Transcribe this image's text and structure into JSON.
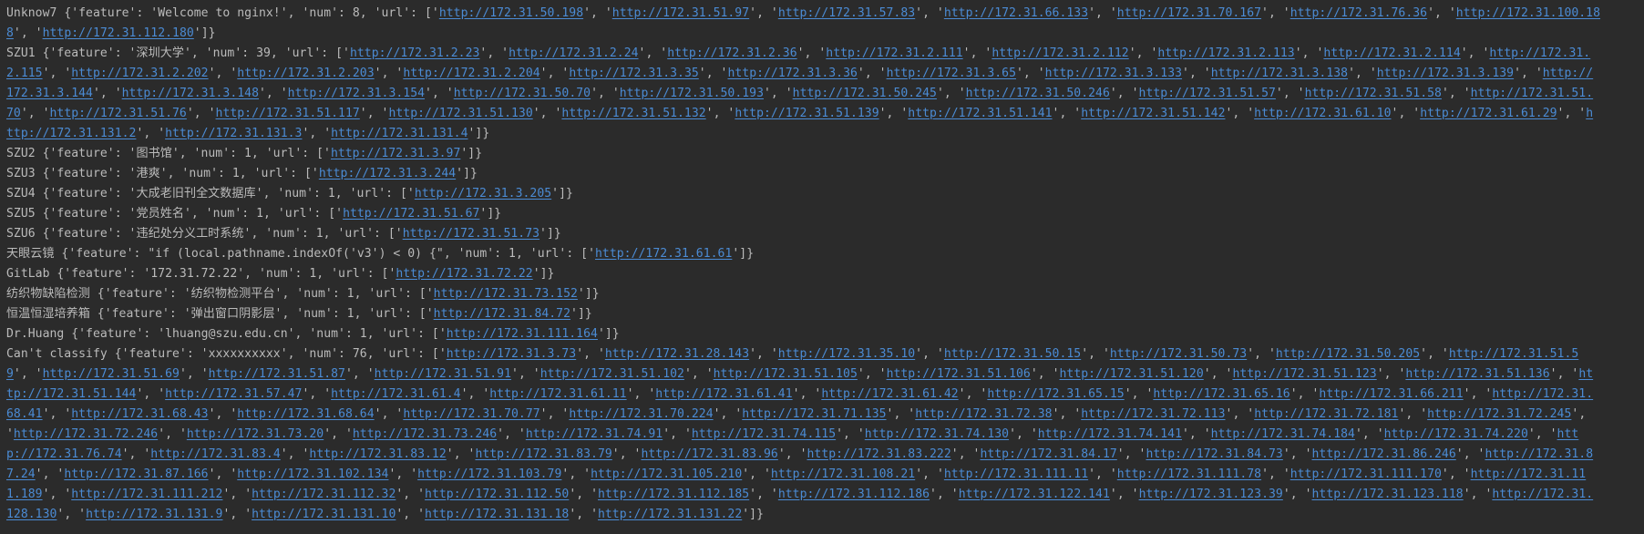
{
  "theme": {
    "background": "#2b2b2b",
    "text": "#bbbbbb",
    "link": "#4b8bd4"
  },
  "lines": [
    {
      "label": "Unknow7",
      "feature": "'Welcome to nginx!'",
      "num": "8",
      "urls": [
        "http://172.31.50.198",
        "http://172.31.51.97",
        "http://172.31.57.83",
        "http://172.31.66.133",
        "http://172.31.70.167",
        "http://172.31.76.36",
        "http://172.31.100.188",
        "http://172.31.112.180"
      ]
    },
    {
      "label": "SZU1",
      "feature": "'深圳大学'",
      "num": "39",
      "urls": [
        "http://172.31.2.23",
        "http://172.31.2.24",
        "http://172.31.2.36",
        "http://172.31.2.111",
        "http://172.31.2.112",
        "http://172.31.2.113",
        "http://172.31.2.114",
        "http://172.31.2.115",
        "http://172.31.2.202",
        "http://172.31.2.203",
        "http://172.31.2.204",
        "http://172.31.3.35",
        "http://172.31.3.36",
        "http://172.31.3.65",
        "http://172.31.3.133",
        "http://172.31.3.138",
        "http://172.31.3.139",
        "http://172.31.3.144",
        "http://172.31.3.148",
        "http://172.31.3.154",
        "http://172.31.50.70",
        "http://172.31.50.193",
        "http://172.31.50.245",
        "http://172.31.50.246",
        "http://172.31.51.57",
        "http://172.31.51.58",
        "http://172.31.51.70",
        "http://172.31.51.76",
        "http://172.31.51.117",
        "http://172.31.51.130",
        "http://172.31.51.132",
        "http://172.31.51.139",
        "http://172.31.51.141",
        "http://172.31.51.142",
        "http://172.31.61.10",
        "http://172.31.61.29",
        "http://172.31.131.2",
        "http://172.31.131.3",
        "http://172.31.131.4"
      ]
    },
    {
      "label": "SZU2",
      "feature": "'图书馆'",
      "num": "1",
      "urls": [
        "http://172.31.3.97"
      ]
    },
    {
      "label": "SZU3",
      "feature": "'港爽'",
      "num": "1",
      "urls": [
        "http://172.31.3.244"
      ]
    },
    {
      "label": "SZU4",
      "feature": "'大成老旧刊全文数据库'",
      "num": "1",
      "urls": [
        "http://172.31.3.205"
      ]
    },
    {
      "label": "SZU5",
      "feature": "'党员姓名'",
      "num": "1",
      "urls": [
        "http://172.31.51.67"
      ]
    },
    {
      "label": "SZU6",
      "feature": "'违纪处分义工时系统'",
      "num": "1",
      "urls": [
        "http://172.31.51.73"
      ]
    },
    {
      "label": "天眼云镜",
      "feature": "\"if (local.pathname.indexOf('v3') < 0) {\"",
      "num": "1",
      "urls": [
        "http://172.31.61.61"
      ]
    },
    {
      "label": "GitLab",
      "feature": "'172.31.72.22'",
      "num": "1",
      "urls": [
        "http://172.31.72.22"
      ]
    },
    {
      "label": "纺织物缺陷检测",
      "feature": "'纺织物检测平台'",
      "num": "1",
      "urls": [
        "http://172.31.73.152"
      ]
    },
    {
      "label": "恒温恒湿培养箱",
      "feature": "'弹出窗口阴影层'",
      "num": "1",
      "urls": [
        "http://172.31.84.72"
      ]
    },
    {
      "label": "Dr.Huang",
      "feature": "'lhuang@szu.edu.cn'",
      "num": "1",
      "urls": [
        "http://172.31.111.164"
      ]
    },
    {
      "label": "Can't classify",
      "feature": "'xxxxxxxxxx'",
      "num": "76",
      "urls": [
        "http://172.31.3.73",
        "http://172.31.28.143",
        "http://172.31.35.10",
        "http://172.31.50.15",
        "http://172.31.50.73",
        "http://172.31.50.205",
        "http://172.31.51.59",
        "http://172.31.51.69",
        "http://172.31.51.87",
        "http://172.31.51.91",
        "http://172.31.51.102",
        "http://172.31.51.105",
        "http://172.31.51.106",
        "http://172.31.51.120",
        "http://172.31.51.123",
        "http://172.31.51.136",
        "http://172.31.51.144",
        "http://172.31.57.47",
        "http://172.31.61.4",
        "http://172.31.61.11",
        "http://172.31.61.41",
        "http://172.31.61.42",
        "http://172.31.65.15",
        "http://172.31.65.16",
        "http://172.31.66.211",
        "http://172.31.68.41",
        "http://172.31.68.43",
        "http://172.31.68.64",
        "http://172.31.70.77",
        "http://172.31.70.224",
        "http://172.31.71.135",
        "http://172.31.72.38",
        "http://172.31.72.113",
        "http://172.31.72.181",
        "http://172.31.72.245",
        "http://172.31.72.246",
        "http://172.31.73.20",
        "http://172.31.73.246",
        "http://172.31.74.91",
        "http://172.31.74.115",
        "http://172.31.74.130",
        "http://172.31.74.141",
        "http://172.31.74.184",
        "http://172.31.74.220",
        "http://172.31.76.74",
        "http://172.31.83.4",
        "http://172.31.83.12",
        "http://172.31.83.79",
        "http://172.31.83.96",
        "http://172.31.83.222",
        "http://172.31.84.17",
        "http://172.31.84.73",
        "http://172.31.86.246",
        "http://172.31.87.24",
        "http://172.31.87.166",
        "http://172.31.102.134",
        "http://172.31.103.79",
        "http://172.31.105.210",
        "http://172.31.108.21",
        "http://172.31.111.11",
        "http://172.31.111.78",
        "http://172.31.111.170",
        "http://172.31.111.189",
        "http://172.31.111.212",
        "http://172.31.112.32",
        "http://172.31.112.50",
        "http://172.31.112.185",
        "http://172.31.112.186",
        "http://172.31.122.141",
        "http://172.31.123.39",
        "http://172.31.123.118",
        "http://172.31.128.130",
        "http://172.31.131.9",
        "http://172.31.131.10",
        "http://172.31.131.18",
        "http://172.31.131.22"
      ]
    }
  ]
}
